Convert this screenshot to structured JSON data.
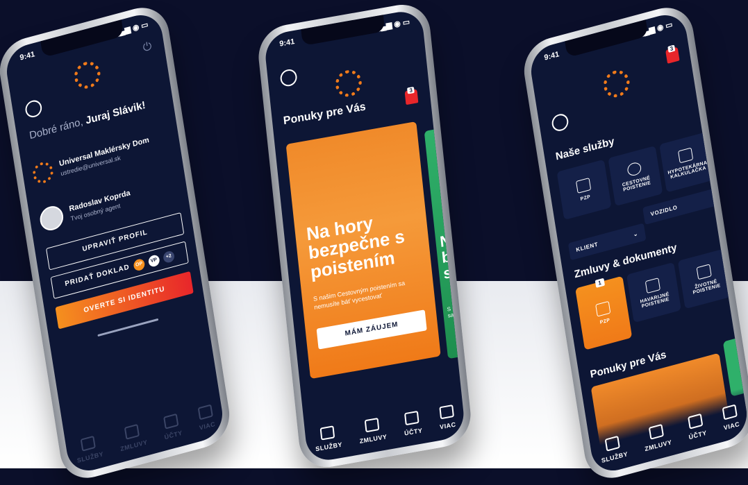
{
  "status_time": "9:41",
  "phone1": {
    "greeting_prefix": "Dobré ráno,",
    "greeting_name": "Juraj Slávik!",
    "company_name": "Universal Maklérsky Dom",
    "company_email": "ustredie@universal.sk",
    "agent_name": "Radoslav Koprda",
    "agent_role": "Tvoj osobný agent",
    "edit_profile": "UPRAVIŤ PROFIL",
    "add_document": "PRIDAŤ DOKLAD",
    "badge_op": "OP",
    "badge_vp": "VP",
    "badge_more": "+2",
    "verify_identity": "OVERTE SI IDENTITU",
    "nav": [
      "SLUŽBY",
      "ZMLUVY",
      "ÚČTY",
      "VIAC"
    ]
  },
  "phone2": {
    "section_title": "Ponuky pre Vás",
    "notif_count": "3",
    "card_headline": "Na hory bezpečne s poistením",
    "card_text": "S našim Cestovným poistením sa nemusíte báť vycestovať",
    "card_button": "MÁM ZÁUJEM",
    "peek_headline": "N b s",
    "peek_text": "S n sa",
    "nav": [
      "SLUŽBY",
      "ZMLUVY",
      "ÚČTY",
      "VIAC"
    ]
  },
  "phone3": {
    "notif_count": "3",
    "services_title": "Naše služby",
    "service_tiles": [
      "PZP",
      "CESTOVNÉ POISTENIE",
      "HYPOTEKÁRNA KALKULAČKA"
    ],
    "filter_vehicle": "VOZIDLO",
    "filter_client": "KLIENT",
    "contracts_title": "Zmluvy & dokumenty",
    "contract_tiles": [
      {
        "label": "PZP",
        "badge": "1"
      },
      {
        "label": "HAVARIJNÉ POISTENIE",
        "badge": ""
      },
      {
        "label": "ŽIVOTNÉ POISTENIE",
        "badge": ""
      }
    ],
    "offers_title": "Ponuky pre Vás",
    "nav": [
      "SLUŽBY",
      "ZMLUVY",
      "ÚČTY",
      "VIAC"
    ]
  },
  "colors": {
    "navy": "#0d1635",
    "accent_orange": "#f5901e",
    "accent_red": "#e8262a",
    "notif_red": "#e8262a"
  }
}
